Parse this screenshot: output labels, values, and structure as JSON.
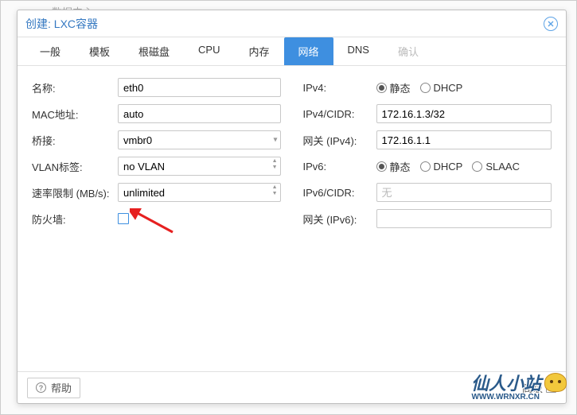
{
  "background_hint": "数据中心",
  "dialog": {
    "title": "创建: LXC容器"
  },
  "tabs": [
    {
      "label": "一般",
      "active": false
    },
    {
      "label": "模板",
      "active": false
    },
    {
      "label": "根磁盘",
      "active": false
    },
    {
      "label": "CPU",
      "active": false
    },
    {
      "label": "内存",
      "active": false
    },
    {
      "label": "网络",
      "active": true
    },
    {
      "label": "DNS",
      "active": false
    },
    {
      "label": "确认",
      "active": false,
      "disabled": true
    }
  ],
  "left": {
    "name": {
      "label": "名称:",
      "value": "eth0"
    },
    "mac": {
      "label": "MAC地址:",
      "value": "auto"
    },
    "bridge": {
      "label": "桥接:",
      "value": "vmbr0"
    },
    "vlan": {
      "label": "VLAN标签:",
      "value": "no VLAN"
    },
    "rate": {
      "label": "速率限制 (MB/s):",
      "value": "unlimited"
    },
    "firewall": {
      "label": "防火墙:"
    }
  },
  "right": {
    "ipv4_mode": {
      "label": "IPv4:",
      "options": [
        {
          "label": "静态",
          "checked": true
        },
        {
          "label": "DHCP",
          "checked": false
        }
      ]
    },
    "ipv4_cidr": {
      "label": "IPv4/CIDR:",
      "value": "172.16.1.3/32"
    },
    "gw4": {
      "label": "网关 (IPv4):",
      "value": "172.16.1.1"
    },
    "ipv6_mode": {
      "label": "IPv6:",
      "options": [
        {
          "label": "静态",
          "checked": true
        },
        {
          "label": "DHCP",
          "checked": false
        },
        {
          "label": "SLAAC",
          "checked": false
        }
      ]
    },
    "ipv6_cidr": {
      "label": "IPv6/CIDR:",
      "placeholder": "无",
      "value": ""
    },
    "gw6": {
      "label": "网关 (IPv6):",
      "value": ""
    }
  },
  "footer": {
    "help": "帮助",
    "advanced": "高级"
  },
  "watermark": {
    "main": "仙人小站",
    "sub": "WWW.WRNXR.CN"
  }
}
